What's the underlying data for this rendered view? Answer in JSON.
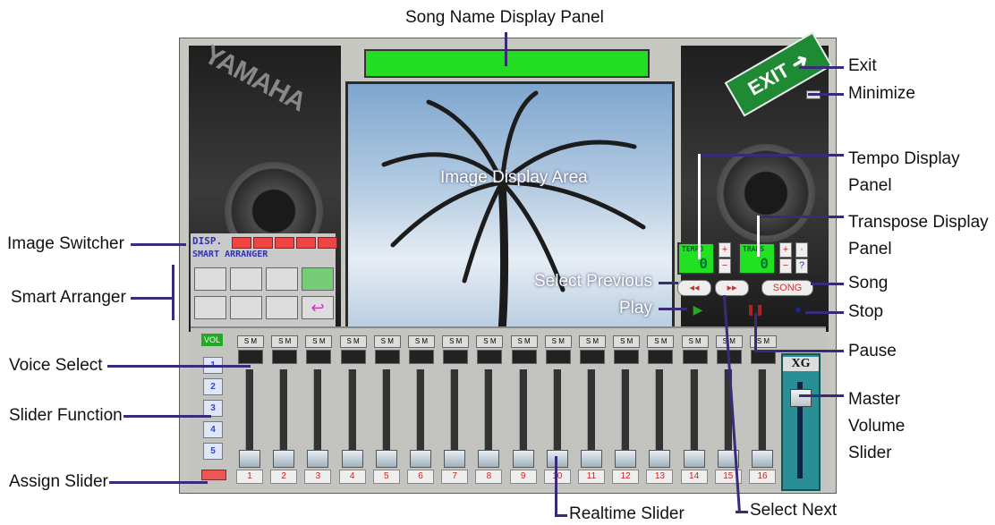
{
  "labels": {
    "song_name_display_panel": "Song Name Display Panel",
    "exit": "Exit",
    "minimize": "Minimize",
    "tempo_display_panel": "Tempo Display\nPanel",
    "transpose_display_panel": "Transpose Display\nPanel",
    "image_display_area": "Image Display Area",
    "image_switcher": "Image Switcher",
    "smart_arranger": "Smart Arranger",
    "select_previous": "Select Previous",
    "play": "Play",
    "song": "Song",
    "stop": "Stop",
    "pause": "Pause",
    "voice_select": "Voice Select",
    "slider_function": "Slider Function",
    "assign_slider": "Assign Slider",
    "master_volume_slider": "Master\nVolume\nSlider",
    "realtime_slider": "Realtime Slider",
    "select_next": "Select Next"
  },
  "app": {
    "brand": "YAMAHA",
    "exit_sign": "EXIT",
    "disp_label": "DISP.",
    "smart_arranger_title": "SMART ARRANGER",
    "vol_label": "VOL",
    "xs_label": "XG",
    "tempo_tag": "TEMPO",
    "tempo_value": "0",
    "transpose_tag": "TRANS",
    "transpose_value": "0",
    "song_button": "SONG",
    "slider_function_buttons": [
      "1",
      "2",
      "3",
      "4",
      "5"
    ],
    "channels": [
      "1",
      "2",
      "3",
      "4",
      "5",
      "6",
      "7",
      "8",
      "9",
      "10",
      "11",
      "12",
      "13",
      "14",
      "15",
      "16"
    ],
    "sm_label": "S M"
  },
  "colors": {
    "lcd_green": "#22dd22",
    "accent_purple": "#3a2a7a",
    "master_teal": "#2a8f94"
  }
}
